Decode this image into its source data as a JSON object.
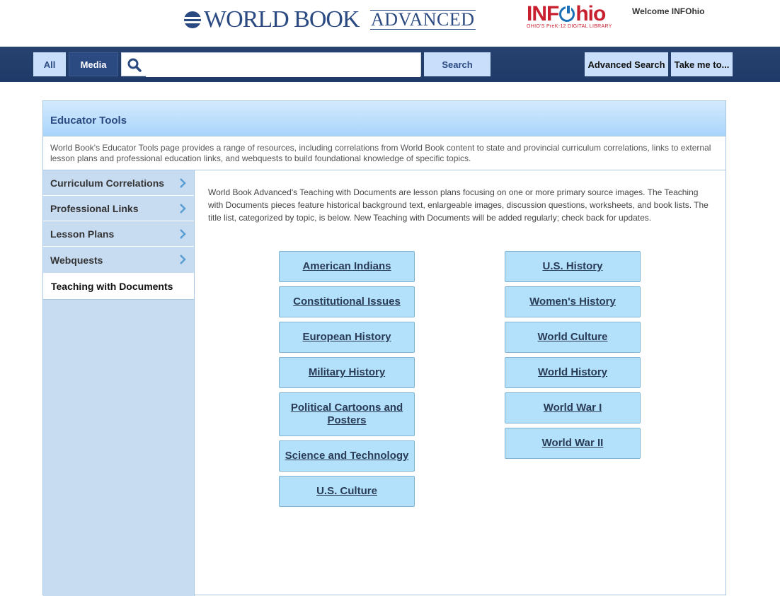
{
  "header": {
    "worldbook_name": "WORLD BOOK",
    "worldbook_edition": "ADVANCED",
    "infohio_name_left": "INF",
    "infohio_name_right": "hio",
    "infohio_tagline": "OHIO'S PreK-12 DIGITAL LIBRARY",
    "welcome_text": "Welcome INFOhio",
    "colors": {
      "worldbook_blue": "#2c4a82",
      "infohio_red": "#c8202f",
      "infohio_blue": "#1b6fb7"
    }
  },
  "navbar": {
    "all_label": "All",
    "media_label": "Media",
    "search_value": "",
    "search_placeholder": "",
    "search_button": "Search",
    "advanced_search": "Advanced Search",
    "take_me_to": "Take me to..."
  },
  "panel": {
    "title": "Educator Tools",
    "description": "World Book's Educator Tools page provides a range of resources, including correlations from World Book content to state and provincial curriculum correlations, links to external lesson plans and professional education links, and webquests to build foundational knowledge of specific topics.",
    "intro": "World Book Advanced's Teaching with Documents are lesson plans focusing on one or more primary source images. The Teaching with Documents pieces feature historical background text, enlargeable images, discussion questions, worksheets, and book lists. The title list, categorized by topic, is below. New Teaching with Documents will be added regularly; check back for updates."
  },
  "sidebar": {
    "items": [
      {
        "label": "Curriculum Correlations"
      },
      {
        "label": "Professional Links"
      },
      {
        "label": "Lesson Plans"
      },
      {
        "label": "Webquests"
      },
      {
        "label": "Teaching with Documents",
        "active": true
      }
    ]
  },
  "topics": {
    "left": [
      "American Indians",
      "Constitutional Issues",
      "European History",
      "Military History",
      "Political Cartoons and Posters",
      "Science and Technology",
      "U.S. Culture"
    ],
    "right": [
      "U.S. History",
      "Women's History",
      "World Culture",
      "World History",
      "World War I",
      "World War II"
    ]
  }
}
